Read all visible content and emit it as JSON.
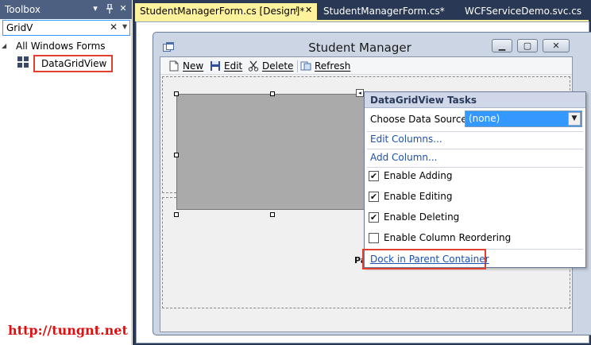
{
  "toolbox": {
    "title": "Toolbox",
    "search": {
      "value": "GridV",
      "clear_glyph": "✕"
    },
    "group": "All Windows Forms",
    "item": "DataGridView"
  },
  "watermark": "http://tungnt.net",
  "tabs": [
    {
      "label": "StudentManagerForm.cs [Design]*",
      "active": true
    },
    {
      "label": "StudentManagerForm.cs*",
      "active": false
    },
    {
      "label": "WCFServiceDemo.svc.cs",
      "active": false
    }
  ],
  "form": {
    "title": "Student Manager",
    "toolstrip": {
      "new": "New",
      "edit": "Edit",
      "delete": "Delete",
      "refresh": "Refresh"
    },
    "panel2_label": "Panel2"
  },
  "tasks": {
    "title": "DataGridView Tasks",
    "data_source_label": "Choose Data Source:",
    "data_source_value": "(none)",
    "edit_columns": "Edit Columns...",
    "add_column": "Add Column...",
    "options": [
      {
        "label": "Enable Adding",
        "checked": true
      },
      {
        "label": "Enable Editing",
        "checked": true
      },
      {
        "label": "Enable Deleting",
        "checked": true
      },
      {
        "label": "Enable Column Reordering",
        "checked": false
      }
    ],
    "dock_link": "Dock in Parent Container"
  },
  "colors": {
    "toolbox_header": "#4d6082",
    "active_tab": "#fff29d",
    "doc_background": "#293955",
    "highlight_box": "#e0402d",
    "link": "#1c4fb0",
    "grid_fill": "#aaaaaa",
    "combo_selection": "#3399ff"
  }
}
